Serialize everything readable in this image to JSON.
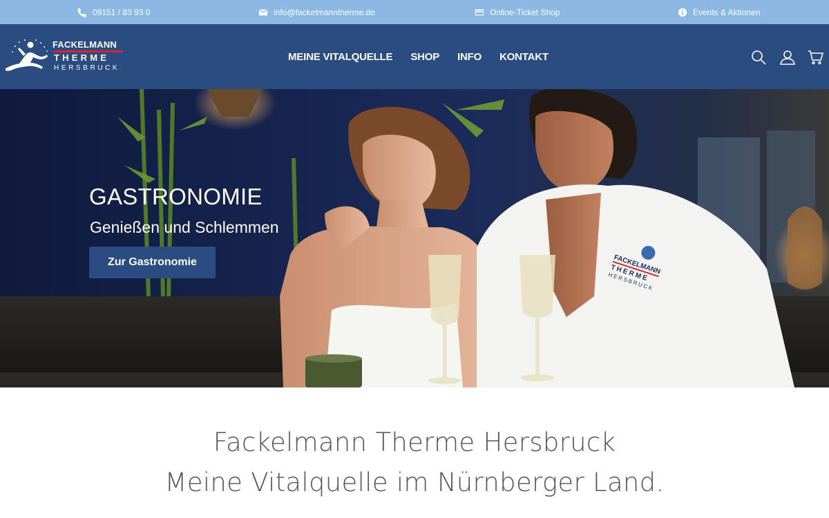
{
  "topbar": {
    "phone": "09151 / 83 93 0",
    "email": "info@fackelmanntherme.de",
    "shop": "Online-Ticket Shop",
    "events": "Events & Aktionen"
  },
  "logo": {
    "line1": "FACKELMANN",
    "line2": "THERME",
    "line3": "HERSBRUCK"
  },
  "nav": {
    "items": [
      "MEINE VITALQUELLE",
      "SHOP",
      "INFO",
      "KONTAKT"
    ]
  },
  "header_icons": [
    "search-icon",
    "user-icon",
    "cart-icon"
  ],
  "hero": {
    "title": "GASTRONOMIE",
    "subtitle": "Genießen und Schlemmen",
    "button": "Zur Gastronomie",
    "robe_logo": {
      "line1": "FACKELMANN",
      "line2": "THERME",
      "line3": "HERSBRUCK"
    }
  },
  "intro": {
    "line1": "Fackelmann Therme Hersbruck",
    "line2": "Meine Vitalquelle im Nürnberger Land."
  },
  "colors": {
    "topbar": "#8db8e4",
    "header": "#2a4c80",
    "button": "#2a4c80",
    "text": "#555555"
  }
}
